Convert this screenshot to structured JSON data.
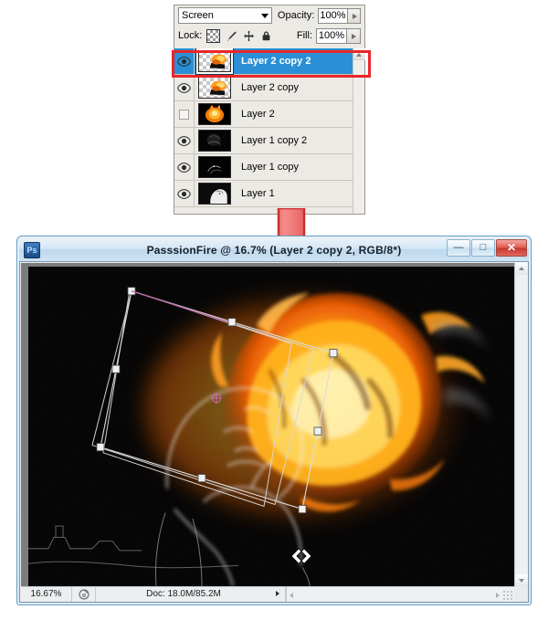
{
  "layers_panel": {
    "blend_mode": {
      "label": "Screen",
      "caret_icon": "chevron-down-icon"
    },
    "opacity": {
      "label": "Opacity:",
      "value": "100%"
    },
    "fill": {
      "label": "Fill:",
      "value": "100%"
    },
    "lock": {
      "label": "Lock:",
      "icons": [
        "transparency-checker-icon",
        "brush-icon",
        "move-cross-icon",
        "padlock-icon"
      ]
    },
    "layers": [
      {
        "name": "Layer 2 copy 2",
        "visible": true,
        "selected": true,
        "thumb": "fire-small-transparent"
      },
      {
        "name": "Layer 2 copy",
        "visible": true,
        "selected": false,
        "thumb": "fire-small-transparent"
      },
      {
        "name": "Layer 2",
        "visible": false,
        "selected": false,
        "thumb": "fire-large-transparent"
      },
      {
        "name": "Layer 1 copy 2",
        "visible": true,
        "selected": false,
        "thumb": "dark-portrait"
      },
      {
        "name": "Layer 1 copy",
        "visible": true,
        "selected": false,
        "thumb": "dark-portrait-edges"
      },
      {
        "name": "Layer 1",
        "visible": true,
        "selected": false,
        "thumb": "bw-portrait"
      }
    ],
    "scroll_up_icon": "scroll-up-arrow-icon",
    "highlight_color": "#e8262a"
  },
  "annotation": {
    "arrow_icon": "down-arrow-annotation",
    "arrow_color": "#ef6a6a",
    "arrow_stroke": "#c92f2f"
  },
  "document_window": {
    "app_icon": "photoshop-icon",
    "app_icon_text": "Ps",
    "title": "PasssionFire @ 16.7% (Layer 2 copy 2, RGB/8*)",
    "window_buttons": [
      {
        "name": "minimize",
        "glyph": "—",
        "icon": "minimize-icon"
      },
      {
        "name": "maximize",
        "glyph": "□",
        "icon": "maximize-icon"
      },
      {
        "name": "close",
        "glyph": "✕",
        "icon": "close-icon"
      }
    ],
    "status_bar": {
      "zoom": "16.67%",
      "preview_icon": "document-preview-icon",
      "doc_info": "Doc: 18.0M/85.2M",
      "doc_arrow_icon": "play-triangle-icon",
      "left_scroll_icon": "scroll-left-arrow-icon",
      "right_scroll_icon": "scroll-right-arrow-icon",
      "resize_grip_icon": "resize-grip-icon"
    },
    "scrollbars": {
      "v_up_icon": "scroll-up-arrow-icon",
      "v_down_icon": "scroll-down-arrow-icon"
    },
    "canvas": {
      "description": "Black background photograph of a person with head tilted back, rendered as white glowing edge outlines, with large orange and yellow flames erupting from the head",
      "transform": {
        "active": true,
        "handles": 8,
        "cursor_icon": "rotate-cursor-icon"
      }
    }
  }
}
